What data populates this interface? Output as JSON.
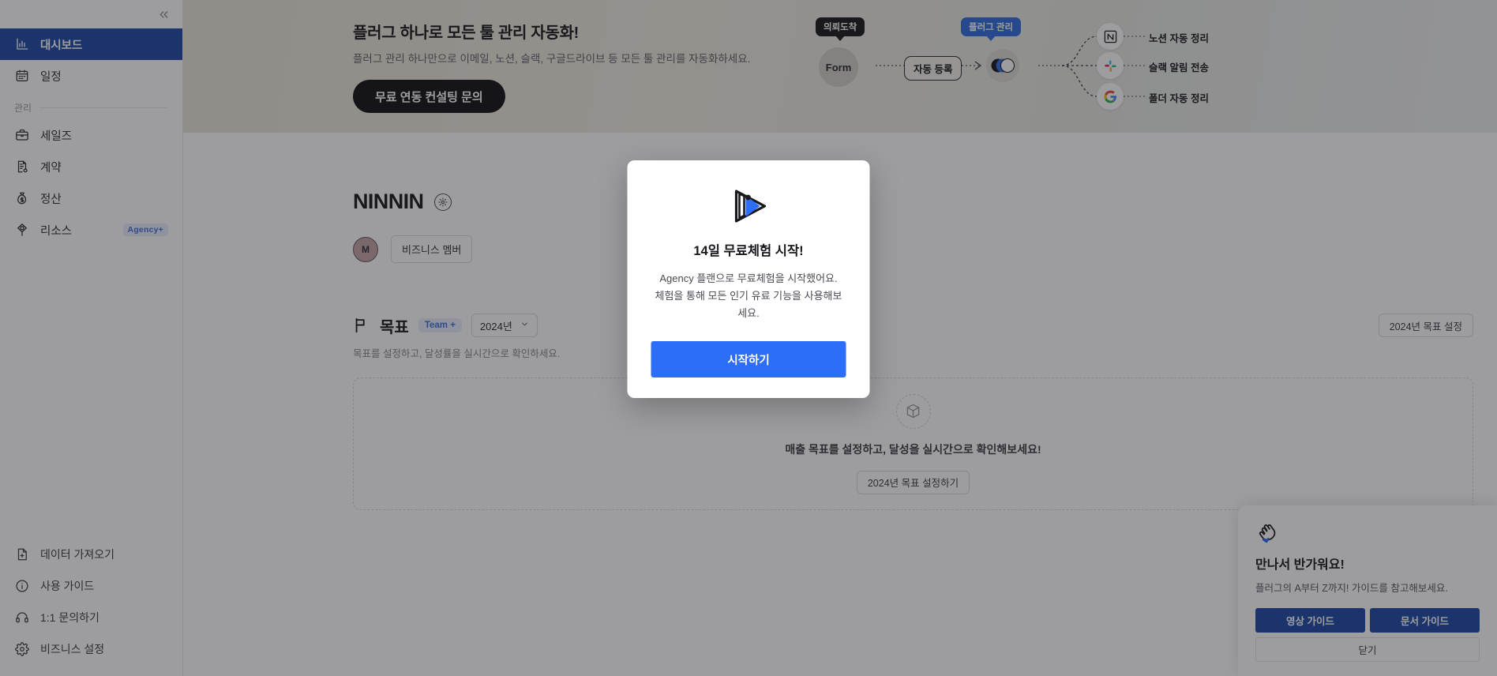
{
  "sidebar": {
    "collapse_icon": "chevrons-left-icon",
    "primary_items": [
      {
        "icon": "chart-dashboard-icon",
        "label": "대시보드",
        "active": true
      },
      {
        "icon": "calendar-icon",
        "label": "일정",
        "active": false
      }
    ],
    "section_label": "관리",
    "manage_items": [
      {
        "icon": "briefcase-icon",
        "label": "세일즈",
        "badge": ""
      },
      {
        "icon": "contract-icon",
        "label": "계약",
        "badge": ""
      },
      {
        "icon": "money-bag-icon",
        "label": "정산",
        "badge": ""
      },
      {
        "icon": "resource-icon",
        "label": "리소스",
        "badge": "Agency+"
      }
    ],
    "bottom_items": [
      {
        "icon": "file-import-icon",
        "label": "데이터 가져오기"
      },
      {
        "icon": "info-circle-icon",
        "label": "사용 가이드"
      },
      {
        "icon": "headset-icon",
        "label": "1:1 문의하기"
      },
      {
        "icon": "gear-icon",
        "label": "비즈니스 설정"
      }
    ]
  },
  "promo": {
    "title": "플러그 하나로 모든 툴 관리 자동화!",
    "subtitle": "플러그 관리 하나만으로 이메일, 노션, 슬랙, 구글드라이브 등 모든 툴 관리를 자동화하세요.",
    "cta": "무료 연동 컨설팅 문의",
    "diagram": {
      "bubble_left": "의뢰도착",
      "bubble_right": "플러그 관리",
      "node_form": "Form",
      "node_auto_register": "자동 등록",
      "apps": [
        {
          "icon": "notion-icon",
          "label": "노션 자동 정리"
        },
        {
          "icon": "slack-icon",
          "label": "슬랙 알림 전송"
        },
        {
          "icon": "google-drive-icon",
          "label": "폴더 자동 정리"
        }
      ]
    }
  },
  "workspace": {
    "brand_name": "NINNIN",
    "settings_icon": "gear-icon",
    "avatar_initial": "M",
    "member_chip": "비즈니스 멤버"
  },
  "goal": {
    "flag_icon": "flag-icon",
    "title": "목표",
    "team_chip": "Team +",
    "year_value": "2024년",
    "chevron_icon": "chevron-down-icon",
    "subtitle": "목표를 설정하고, 달성률을 실시간으로 확인하세요.",
    "setting_button": "2024년 목표 설정",
    "empty": {
      "icon": "cube-icon",
      "text": "매출 목표를 설정하고, 달성을 실시간으로 확인해보세요!",
      "button": "2024년 목표 설정하기"
    }
  },
  "modal": {
    "logo_icon": "plug-logo-icon",
    "title": "14일 무료체험 시작!",
    "desc_line1": "Agency 플랜으로 무료체험을 시작했어요.",
    "desc_line2": "체험을 통해 모든 인기 유료 기능을 사용해보세요.",
    "primary_button": "시작하기",
    "accent_color": "#2c6ef7"
  },
  "welcome": {
    "wave_icon": "waving-hand-icon",
    "title": "만나서 반가워요!",
    "subtitle": "플러그의 A부터 Z까지! 가이드를 참고해보세요.",
    "video_button": "영상 가이드",
    "doc_button": "문서 가이드",
    "close_button": "닫기",
    "button_color": "#1b49a6"
  }
}
